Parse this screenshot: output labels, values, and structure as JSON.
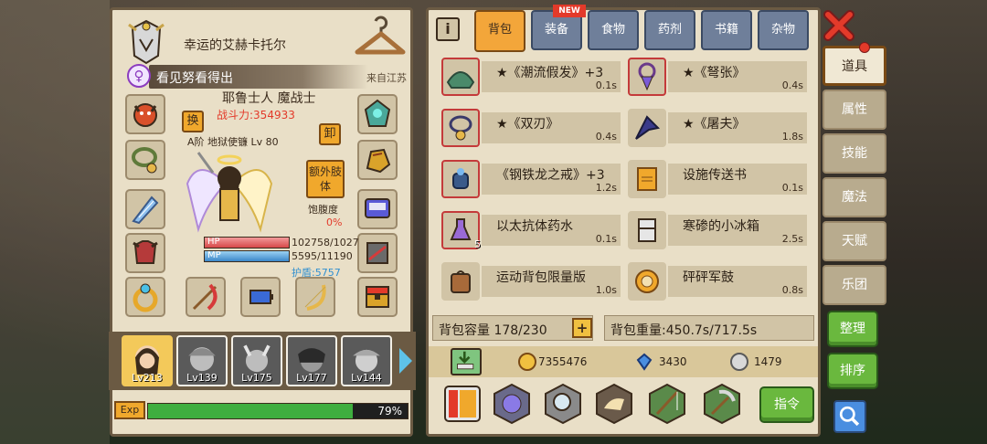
{
  "character": {
    "name": "幸运的艾赫卡托尔",
    "motto": "看见努看得出",
    "origin": "来自江苏",
    "race_class": "耶鲁士人 魔战士",
    "power": "战斗力:354933",
    "weapon_line": "A阶 地狱使镰 Lv 80",
    "swap_label": "换",
    "unequip_label": "卸",
    "extra_limb_label": "额外肢体",
    "satiety_label": "饱腹度",
    "satiety_value": "0%",
    "hp_label": "HP",
    "mp_label": "MP",
    "hp_value": "102758/1027",
    "mp_value": "5595/11190",
    "shield_value": "护盾:5757"
  },
  "team": [
    {
      "level": "Lv213",
      "active": true
    },
    {
      "level": "Lv139",
      "active": false
    },
    {
      "level": "Lv175",
      "active": false
    },
    {
      "level": "Lv177",
      "active": false
    },
    {
      "level": "Lv144",
      "active": false
    }
  ],
  "exp": {
    "label": "Exp",
    "value": "79%",
    "fraction": 0.79
  },
  "tabs": {
    "backpack": "背包",
    "equipment": "装备",
    "food": "食物",
    "potion": "药剂",
    "books": "书籍",
    "misc": "杂物",
    "new_badge": "NEW"
  },
  "items": [
    {
      "name": "★《潮流假发》+3",
      "weight": "0.1s"
    },
    {
      "name": "★《弩张》",
      "weight": "0.4s"
    },
    {
      "name": "★《双刃》",
      "weight": "0.4s"
    },
    {
      "name": "★《屠夫》",
      "weight": "1.8s"
    },
    {
      "name": "《钢铁龙之戒》+3",
      "weight": "1.2s"
    },
    {
      "name": "设施传送书",
      "weight": "0.1s"
    },
    {
      "name": "以太抗体药水",
      "weight": "0.1s",
      "count": "5"
    },
    {
      "name": "寒碜的小冰箱",
      "weight": "2.5s"
    },
    {
      "name": "运动背包限量版",
      "weight": "1.0s"
    },
    {
      "name": "砰砰军鼓",
      "weight": "0.8s"
    }
  ],
  "capacity": {
    "label": "背包容量 178/230",
    "plus": "+"
  },
  "weight": {
    "label": "背包重量:450.7s/717.5s"
  },
  "currency": {
    "gold": "7355476",
    "diamond": "3430",
    "silver": "1479"
  },
  "command_label": "指令",
  "side_tabs": [
    "道具",
    "属性",
    "技能",
    "魔法",
    "天赋",
    "乐团"
  ],
  "sort_buttons": {
    "arrange": "整理",
    "order": "排序"
  },
  "colors": {
    "accent": "#f3a63a",
    "green": "#6ab83e",
    "panel": "#e9dfc7",
    "hp": "#d64848",
    "mp": "#3a86c9"
  }
}
